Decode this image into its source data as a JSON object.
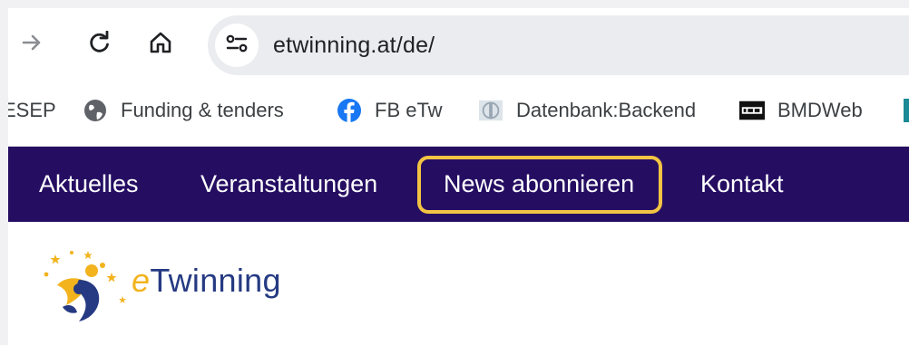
{
  "browser": {
    "url": "etwinning.at/de/",
    "icons": [
      "forward-arrow-icon",
      "reload-icon",
      "home-icon",
      "site-settings-icon"
    ]
  },
  "bookmarks": [
    {
      "label": "ESEP",
      "icon": "none"
    },
    {
      "label": "Funding & tenders",
      "icon": "globe-icon"
    },
    {
      "label": "FB eTw",
      "icon": "facebook-icon"
    },
    {
      "label": "Datenbank:Backend",
      "icon": "database-icon"
    },
    {
      "label": "BMDWeb",
      "icon": "bmd-icon"
    }
  ],
  "site_nav": {
    "items": [
      "Aktuelles",
      "Veranstaltungen",
      "News abonnieren",
      "Kontakt"
    ],
    "highlighted": "News abonnieren",
    "background": "#250e62",
    "highlight_color": "#f3c443"
  },
  "logo": {
    "letter_e": "e",
    "rest": "Twinning",
    "colors": {
      "e": "#f2b31d",
      "text": "#253a82"
    }
  }
}
